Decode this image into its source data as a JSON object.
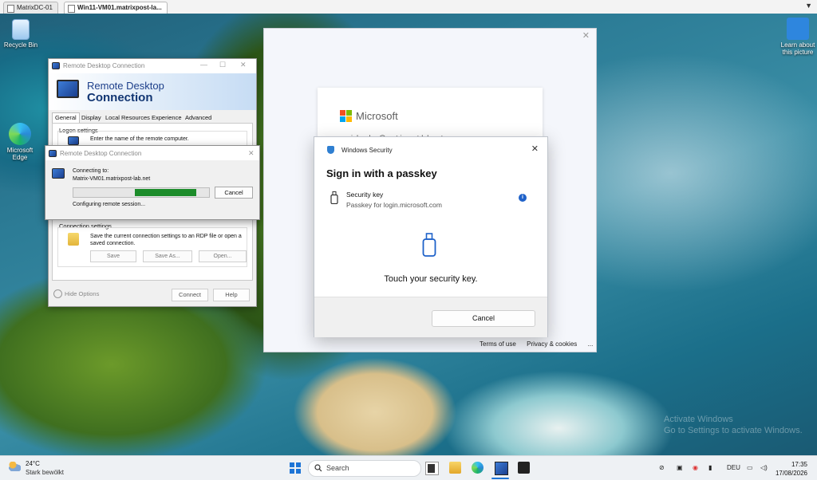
{
  "host": {
    "tabs": [
      {
        "label": "MatrixDC-01"
      },
      {
        "label": "Win11-VM01.matrixpost-la..."
      }
    ]
  },
  "desktop": {
    "icons": [
      {
        "label": "Recycle Bin",
        "icon": "recycle-bin-icon"
      },
      {
        "label": "Microsoft Edge",
        "icon": "edge-icon"
      },
      {
        "label": "Learn about this picture",
        "icon": "learn-picture-icon"
      }
    ],
    "watermark": {
      "line1": "Activate Windows",
      "line2": "Go to Settings to activate Windows."
    }
  },
  "rdc": {
    "title": "Remote Desktop Connection",
    "banner": {
      "line1": "Remote Desktop",
      "line2": "Connection"
    },
    "tabs": [
      "General",
      "Display",
      "Local Resources",
      "Experience",
      "Advanced"
    ],
    "active_tab": "General",
    "logon_settings": {
      "label": "Logon settings",
      "hint": "Enter the name of the remote computer."
    },
    "connection_settings": {
      "label": "Connection settings",
      "hint": "Save the current connection settings to an RDP file or open a saved connection.",
      "save": "Save",
      "save_as": "Save As...",
      "open": "Open..."
    },
    "hide_options": "Hide Options",
    "connect": "Connect",
    "help": "Help"
  },
  "progress_dialog": {
    "title": "Remote Desktop Connection",
    "connecting_to": "Connecting to:",
    "host": "Matrix-VM01.matrixpost-lab.net",
    "status": "Configuring remote session...",
    "cancel": "Cancel",
    "progress": {
      "start": 0.45,
      "end": 0.9
    }
  },
  "signin": {
    "brand": "Microsoft",
    "email": "john.doe@matrixpost-lab.net",
    "footer": {
      "terms": "Terms of use",
      "privacy": "Privacy & cookies",
      "more": "..."
    }
  },
  "winsec": {
    "title": "Windows Security",
    "heading": "Sign in with a passkey",
    "option": {
      "title": "Security key",
      "subtitle": "Passkey for login.microsoft.com"
    },
    "instruction": "Touch your security key.",
    "cancel": "Cancel"
  },
  "taskbar": {
    "weather": {
      "temp": "24°C",
      "condition": "Stark bewölkt"
    },
    "search_placeholder": "Search",
    "language": "DEU",
    "time": "17:35",
    "date": "17/08/2026"
  },
  "colors": {
    "accent": "#1d74d6",
    "progress": "#1c8c2a",
    "ms_red": "#f25022",
    "ms_green": "#7fba00",
    "ms_blue": "#00a4ef",
    "ms_yellow": "#ffb900"
  }
}
